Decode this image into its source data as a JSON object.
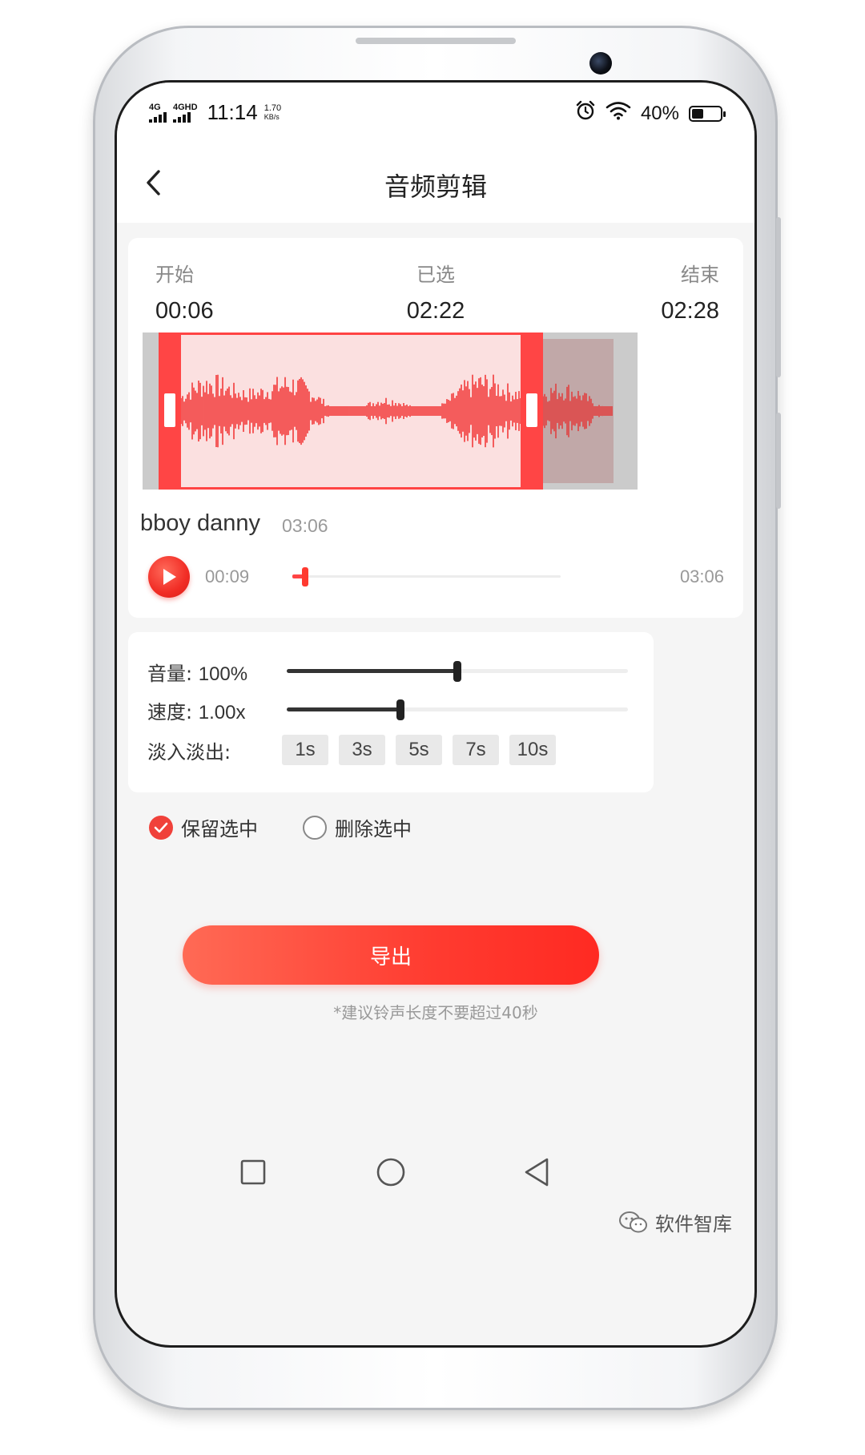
{
  "status_bar": {
    "net1": "4G",
    "net2": "4GHD",
    "time": "11:14",
    "speed_value": "1.70",
    "speed_unit": "KB/s",
    "battery": "40%"
  },
  "title_bar": {
    "title": "音频剪辑"
  },
  "clip": {
    "start_label": "开始",
    "start_value": "00:06",
    "selected_label": "已选",
    "selected_value": "02:22",
    "end_label": "结束",
    "end_value": "02:28"
  },
  "track": {
    "name": "bboy danny",
    "duration": "03:06",
    "current_time": "00:09",
    "total_time": "03:06",
    "progress_fraction": 0.048
  },
  "settings": {
    "volume_label": "音量:",
    "volume_value": "100%",
    "volume_fraction": 0.5,
    "speed_label": "速度:",
    "speed_value": "1.00x",
    "speed_fraction": 0.333,
    "fade_label": "淡入淡出:",
    "fade_options": [
      "1s",
      "3s",
      "5s",
      "7s",
      "10s"
    ]
  },
  "options": {
    "keep_label": "保留选中",
    "keep_checked": true,
    "delete_label": "删除选中",
    "delete_checked": false
  },
  "export": {
    "button_label": "导出",
    "hint": "*建议铃声长度不要超过40秒"
  },
  "watermark": {
    "text": "软件智库"
  },
  "colors": {
    "accent": "#ff4444",
    "export_start": "#ff6a55",
    "export_end": "#ff2a22",
    "wave_selected_bg": "#fbe0e0"
  },
  "icons": {
    "back": "chevron-left-icon",
    "play": "play-icon",
    "alarm": "alarm-icon",
    "wifi": "wifi-icon",
    "battery": "battery-icon",
    "nav_recent": "square-icon",
    "nav_home": "circle-icon",
    "nav_back": "triangle-left-icon",
    "wechat": "wechat-icon"
  }
}
